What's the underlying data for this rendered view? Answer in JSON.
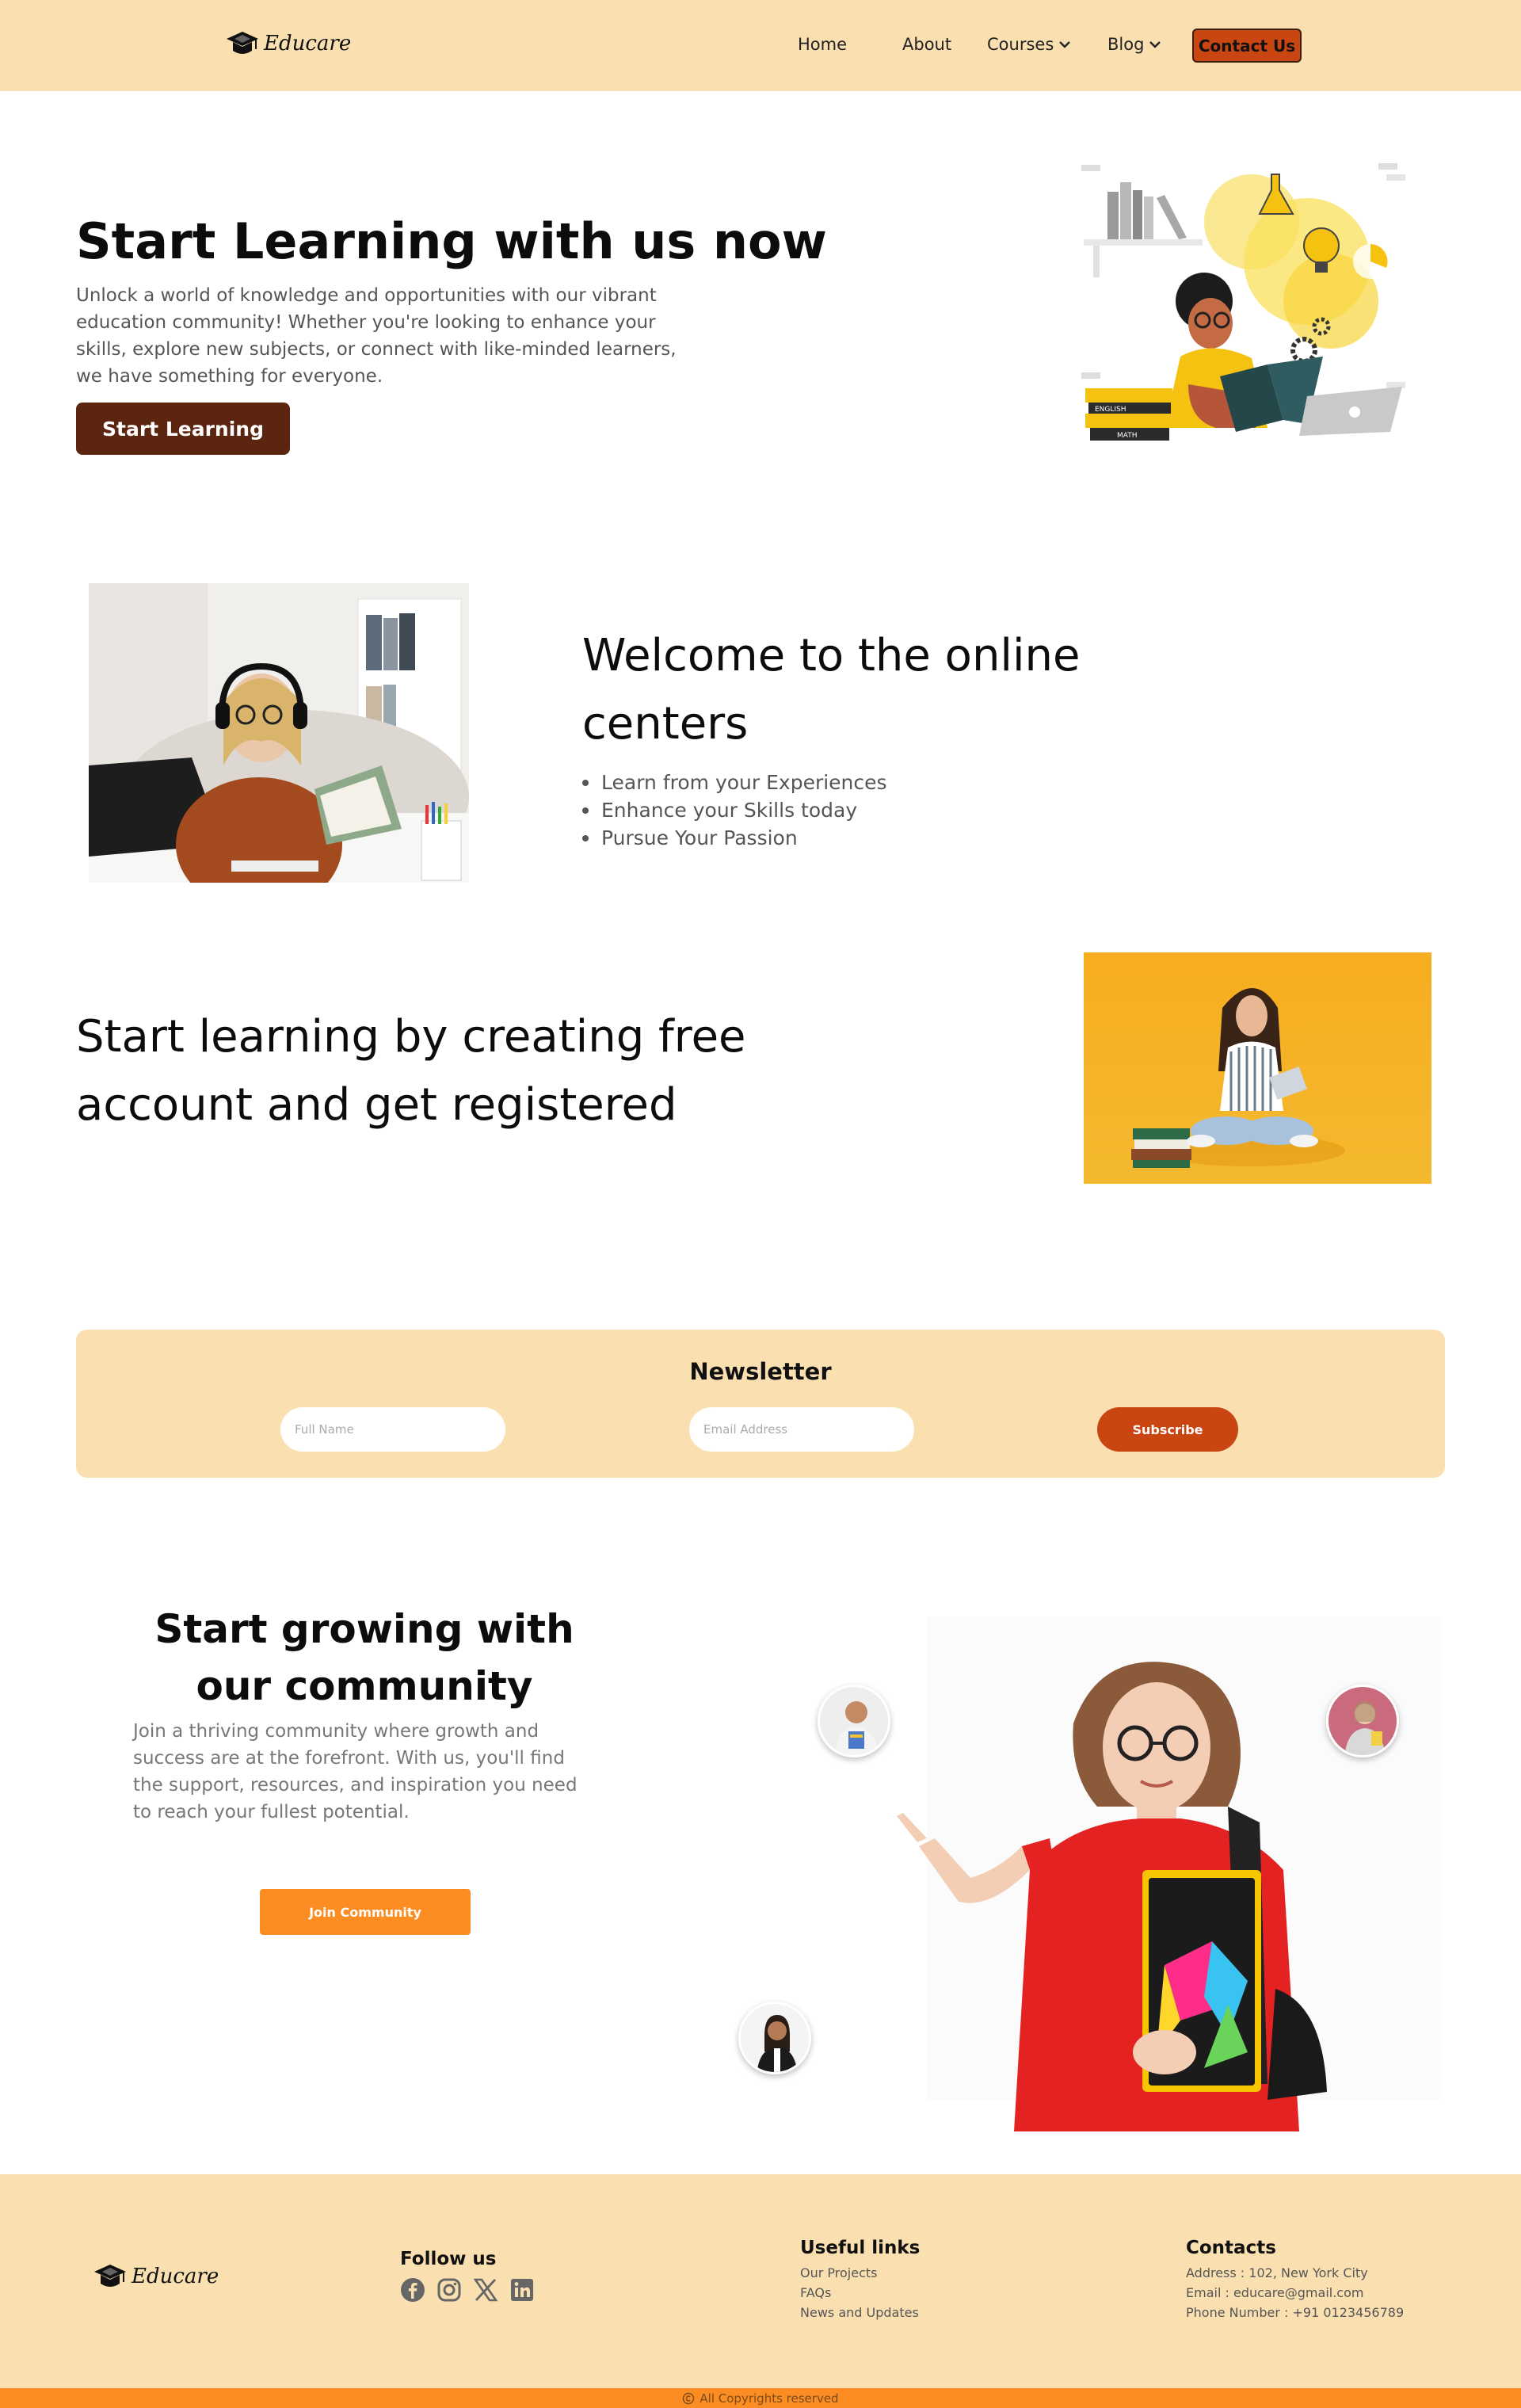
{
  "brand": {
    "name": "Educare"
  },
  "nav": {
    "home": "Home",
    "about": "About",
    "courses": "Courses",
    "blog": "Blog",
    "contact": "Contact Us"
  },
  "hero": {
    "title": "Start Learning with us now",
    "description": "Unlock a world of knowledge and opportunities with our vibrant education community! Whether you're looking to enhance your skills, explore new subjects, or connect with like-minded learners, we have something for everyone.",
    "button": "Start Learning",
    "book_labels": [
      "ENGLISH",
      "MATH"
    ]
  },
  "welcome": {
    "title": "Welcome to the online centers",
    "bullets": [
      "Learn from your Experiences",
      "Enhance your Skills today",
      "Pursue Your Passion"
    ]
  },
  "register": {
    "title": "Start learning by creating free account and get registered"
  },
  "newsletter": {
    "title": "Newsletter",
    "name_placeholder": "Full Name",
    "email_placeholder": "Email Address",
    "button": "Subscribe"
  },
  "community": {
    "title": "Start growing with our community",
    "description": "Join a thriving community where growth and success are at the forefront. With us, you'll find the support, resources, and inspiration you need to reach your fullest potential.",
    "button": "Join Community"
  },
  "footer": {
    "follow_title": "Follow us",
    "social_icons": [
      "facebook-icon",
      "instagram-icon",
      "x-icon",
      "linkedin-icon"
    ],
    "useful_title": "Useful links",
    "useful_links": [
      "Our Projects",
      "FAQs",
      "News and Updates"
    ],
    "contacts_title": "Contacts",
    "address": "Address : 102, New York City",
    "email": "Email : educare@gmail.com",
    "phone": "Phone Number : +91 0123456789",
    "copyright": "All Copyrights reserved"
  },
  "colors": {
    "cream": "#fae0b1",
    "brown": "#5c250f",
    "rust": "#c94511",
    "orange": "#fb8d22"
  }
}
